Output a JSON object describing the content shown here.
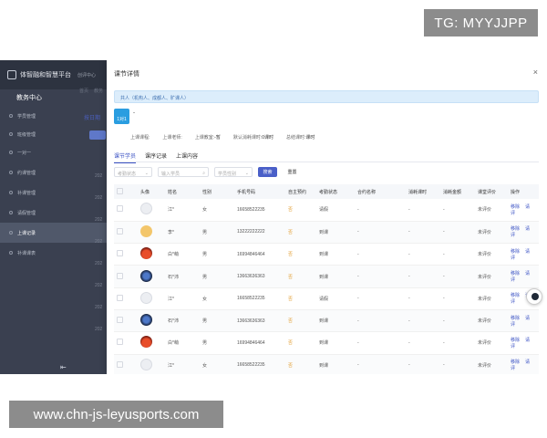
{
  "watermark_top": "TG: MYYJJPP",
  "watermark_bottom": "www.chn-js-leyusports.com",
  "app": {
    "title": "体智融和智慧平台",
    "subtitle": "创评中心",
    "section": "教务中心",
    "menu": [
      {
        "label": "学员管理",
        "active": false
      },
      {
        "label": "班级管理",
        "active": false
      },
      {
        "label": "一对一",
        "active": false
      },
      {
        "label": "约课管理",
        "active": false
      },
      {
        "label": "补课管理",
        "active": false
      },
      {
        "label": "请假管理",
        "active": false
      },
      {
        "label": "上课记录",
        "active": true
      },
      {
        "label": "补课课表",
        "active": false
      }
    ],
    "crumbs": [
      "首页",
      "教务"
    ],
    "bg_tab": "按日期",
    "bg_years": [
      "202",
      "202",
      "202",
      "202",
      "202",
      "202",
      "202",
      "202"
    ]
  },
  "modal": {
    "title": "课节详情",
    "close": "×",
    "notice": "共人（机构人、成都人、旷课人）",
    "course_name": "-",
    "course_badge": "1对1",
    "info": [
      {
        "label": "上课课程:",
        "value": ""
      },
      {
        "label": "上课老师:",
        "value": ""
      },
      {
        "label": "上课教室:",
        "value": "-暂"
      },
      {
        "label": "默认消耗课时:",
        "value": "0课时"
      },
      {
        "label": "总结课时:",
        "value": "课时"
      }
    ],
    "tabs": [
      "课节学员",
      "课序记录",
      "上课内容"
    ],
    "filters": {
      "status_placeholder": "考勤状态",
      "student_placeholder": "输入学员",
      "gender_placeholder": "学员性别",
      "search": "搜索",
      "reset": "重置"
    },
    "columns": [
      "",
      "头像",
      "姓名",
      "性别",
      "手机号码",
      "自主预约",
      "考勤状态",
      "合约名称",
      "消耗课时",
      "消耗金额",
      "课堂评价",
      "操作"
    ],
    "rows": [
      {
        "avatar": "light",
        "name": "江*",
        "gender": "女",
        "phone": "16658522235",
        "self": "否",
        "attend": "请假",
        "contract": "-",
        "hours": "-",
        "amount": "-",
        "eval": "未评价"
      },
      {
        "avatar": "cat",
        "name": "李*",
        "gender": "男",
        "phone": "13222222222",
        "self": "否",
        "attend": "到课",
        "contract": "-",
        "hours": "-",
        "amount": "-",
        "eval": "未评价"
      },
      {
        "avatar": "red",
        "name": "白*萌",
        "gender": "男",
        "phone": "16994846464",
        "self": "否",
        "attend": "到课",
        "contract": "-",
        "hours": "-",
        "amount": "-",
        "eval": "未评价"
      },
      {
        "avatar": "blue",
        "name": "石*沛",
        "gender": "男",
        "phone": "13663636363",
        "self": "否",
        "attend": "到课",
        "contract": "-",
        "hours": "-",
        "amount": "-",
        "eval": "未评价"
      },
      {
        "avatar": "light",
        "name": "江*",
        "gender": "女",
        "phone": "16658522235",
        "self": "否",
        "attend": "请假",
        "contract": "-",
        "hours": "-",
        "amount": "-",
        "eval": "未评价"
      },
      {
        "avatar": "blue",
        "name": "石*沛",
        "gender": "男",
        "phone": "13663636363",
        "self": "否",
        "attend": "到课",
        "contract": "-",
        "hours": "-",
        "amount": "-",
        "eval": "未评价"
      },
      {
        "avatar": "red",
        "name": "白*萌",
        "gender": "男",
        "phone": "16994846464",
        "self": "否",
        "attend": "到课",
        "contract": "-",
        "hours": "-",
        "amount": "-",
        "eval": "未评价"
      },
      {
        "avatar": "light",
        "name": "江*",
        "gender": "女",
        "phone": "16658522235",
        "self": "否",
        "attend": "到课",
        "contract": "-",
        "hours": "-",
        "amount": "-",
        "eval": "未评价"
      }
    ],
    "ops": [
      "移除",
      "请评"
    ]
  }
}
